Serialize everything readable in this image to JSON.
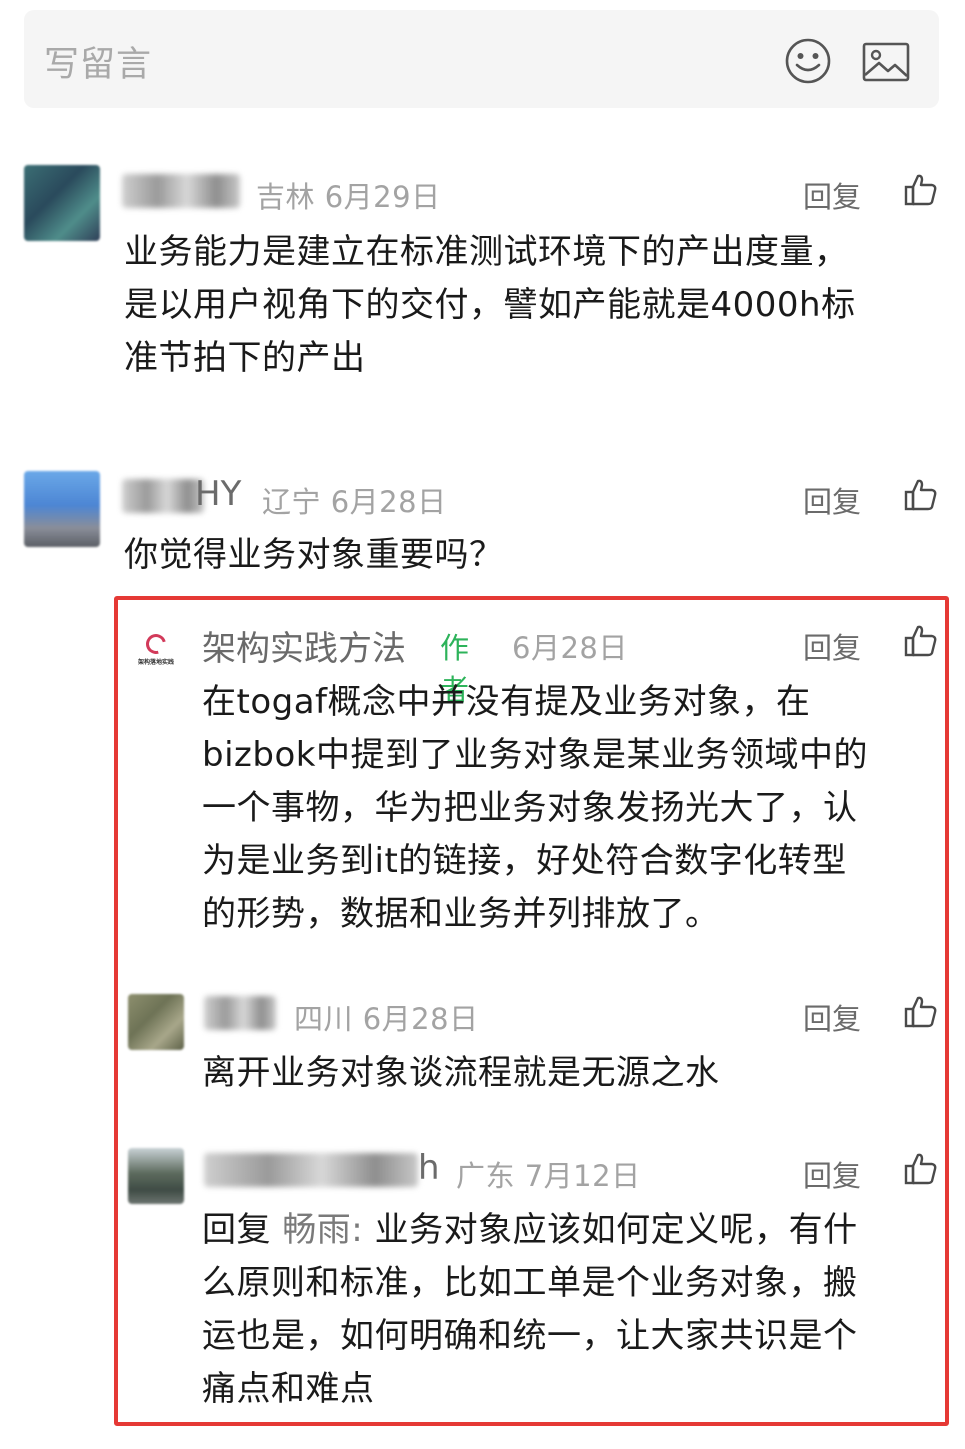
{
  "write_bar": {
    "placeholder": "写留言",
    "emoji_icon": "smiley-face-icon",
    "image_icon": "image-icon"
  },
  "reply_label": "回复",
  "like_icon": "thumbs-up-icon",
  "highlight_color": "#e53935",
  "author_tag_color": "#2db35a",
  "comments": [
    {
      "name_tail": "",
      "meta": "吉林 6月29日",
      "text_lines": [
        "业务能力是建立在标准测试环境下的产出度量，",
        "是以用户视角下的交付，譬如产能就是4000h标",
        "准节拍下的产出"
      ]
    },
    {
      "name_tail": "HY",
      "meta": "辽宁 6月28日",
      "text_lines": [
        "你觉得业务对象重要吗？"
      ]
    }
  ],
  "replies": [
    {
      "author": "架构实践方法",
      "author_tag": "作者",
      "avatar_text": "架构落地实践",
      "meta": "6月28日",
      "text_lines": [
        "在togaf概念中并没有提及业务对象，在",
        "bizbok中提到了业务对象是某业务领域中的",
        "一个事物，华为把业务对象发扬光大了，认",
        "为是业务到it的链接，好处符合数字化转型",
        "的形势，数据和业务并列排放了。"
      ]
    },
    {
      "name_tail": "",
      "meta": "四川 6月28日",
      "text_lines": [
        "离开业务对象谈流程就是无源之水"
      ]
    },
    {
      "name_tail": "h",
      "meta": "广东 7月12日",
      "reply_prefix": "回复",
      "reply_target": "畅雨:",
      "text_lines": [
        " 业务对象应该如何定义呢，有什",
        "么原则和标准，比如工单是个业务对象，搬",
        "运也是，如何明确和统一，让大家共识是个",
        "痛点和难点"
      ]
    }
  ]
}
